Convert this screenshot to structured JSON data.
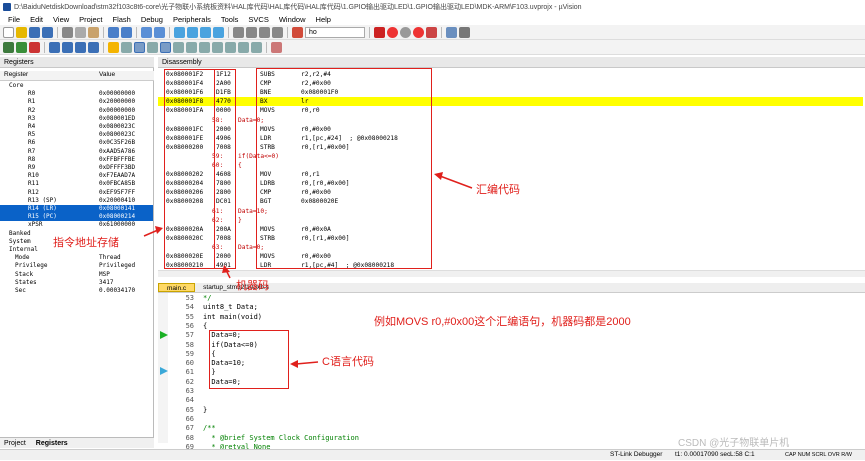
{
  "window": {
    "title": "D:\\BaiduNetdiskDownload\\stm32f103c8t6-core\\光子物联小系统板资料\\HAL库代码\\HAL库代码\\HAL库代码\\1.GPIO输出驱动LED\\1.GPIO输出驱动LED\\MDK-ARM\\F103.uvprojx - µVision"
  },
  "menu": [
    "File",
    "Edit",
    "View",
    "Project",
    "Flash",
    "Debug",
    "Peripherals",
    "Tools",
    "SVCS",
    "Window",
    "Help"
  ],
  "toolbar": {
    "find_text": "ho"
  },
  "registers": {
    "title": "Registers",
    "col_register": "Register",
    "col_value": "Value",
    "core_label": "Core",
    "rows": [
      {
        "name": "R0",
        "value": "0x00000000"
      },
      {
        "name": "R1",
        "value": "0x20000000"
      },
      {
        "name": "R2",
        "value": "0x00000000"
      },
      {
        "name": "R3",
        "value": "0x080001ED"
      },
      {
        "name": "R4",
        "value": "0x0800023C"
      },
      {
        "name": "R5",
        "value": "0x0800023C"
      },
      {
        "name": "R6",
        "value": "0x0C35F26B"
      },
      {
        "name": "R7",
        "value": "0xAAD5A786"
      },
      {
        "name": "R8",
        "value": "0xFFBFFFBE"
      },
      {
        "name": "R9",
        "value": "0xDFFFF3BD"
      },
      {
        "name": "R10",
        "value": "0xF7EAAD7A"
      },
      {
        "name": "R11",
        "value": "0x0FBCA85B"
      },
      {
        "name": "R12",
        "value": "0xEF95F7FF"
      },
      {
        "name": "R13 (SP)",
        "value": "0x20000410"
      },
      {
        "name": "R14 (LR)",
        "value": "0x08000141"
      },
      {
        "name": "R15 (PC)",
        "value": "0x08000214"
      },
      {
        "name": "xPSR",
        "value": "0x61000000"
      }
    ],
    "groups": [
      "Banked",
      "System",
      "Internal"
    ],
    "internal": [
      {
        "name": "Mode",
        "value": "Thread"
      },
      {
        "name": "Privilege",
        "value": "Privileged"
      },
      {
        "name": "Stack",
        "value": "MSP"
      },
      {
        "name": "States",
        "value": "3417"
      },
      {
        "name": "Sec",
        "value": "0.00034170"
      }
    ],
    "tab_project": "Project",
    "tab_registers": "Registers"
  },
  "disassembly": {
    "title": "Disassembly",
    "rows": [
      {
        "addr": "0x080001F2",
        "code": "1F12",
        "mn": "SUBS",
        "op": "r2,r2,#4"
      },
      {
        "addr": "0x080001F4",
        "code": "2A00",
        "mn": "CMP",
        "op": "r2,#0x00"
      },
      {
        "addr": "0x080001F6",
        "code": "D1FB",
        "mn": "BNE",
        "op": "0x080001F0"
      },
      {
        "addr": "0x080001F8",
        "code": "4770",
        "mn": "BX",
        "op": "lr",
        "hl": true
      },
      {
        "addr": "0x080001FA",
        "code": "0000",
        "mn": "MOVS",
        "op": "r0,r0"
      },
      {
        "src_num": "58:",
        "src_txt": "Data=0;"
      },
      {
        "addr": "0x080001FC",
        "code": "2000",
        "mn": "MOVS",
        "op": "r0,#0x00"
      },
      {
        "addr": "0x080001FE",
        "code": "4906",
        "mn": "LDR",
        "op": "r1,[pc,#24]  ; @0x08000218"
      },
      {
        "addr": "0x08000200",
        "code": "7008",
        "mn": "STRB",
        "op": "r0,[r1,#0x00]"
      },
      {
        "src_num": "59:",
        "src_txt": "if(Data<=0)"
      },
      {
        "src_num": "60:",
        "src_txt": "{"
      },
      {
        "addr": "0x08000202",
        "code": "4608",
        "mn": "MOV",
        "op": "r0,r1"
      },
      {
        "addr": "0x08000204",
        "code": "7800",
        "mn": "LDRB",
        "op": "r0,[r0,#0x00]"
      },
      {
        "addr": "0x08000206",
        "code": "2800",
        "mn": "CMP",
        "op": "r0,#0x00"
      },
      {
        "addr": "0x08000208",
        "code": "DC01",
        "mn": "BGT",
        "op": "0x0800020E"
      },
      {
        "src_num": "61:",
        "src_txt": "Data=10;"
      },
      {
        "src_num": "62:",
        "src_txt": "}"
      },
      {
        "addr": "0x0800020A",
        "code": "200A",
        "mn": "MOVS",
        "op": "r0,#0x0A"
      },
      {
        "addr": "0x0800020C",
        "code": "7008",
        "mn": "STRB",
        "op": "r0,[r1,#0x00]"
      },
      {
        "src_num": "63:",
        "src_txt": "Data=0;"
      },
      {
        "addr": "0x0800020E",
        "code": "2000",
        "mn": "MOVS",
        "op": "r0,#0x00"
      },
      {
        "addr": "0x08000210",
        "code": "4901",
        "mn": "LDR",
        "op": "r1,[pc,#4]  ; @0x08000218"
      }
    ]
  },
  "editor": {
    "tabs": [
      "main.c",
      "startup_stm32f103xb.s"
    ],
    "lines": [
      {
        "n": "53",
        "t": "*/",
        "cls": "cm"
      },
      {
        "n": "54",
        "t": "uint8_t Data;"
      },
      {
        "n": "55",
        "t": "int main(void)"
      },
      {
        "n": "56",
        "t": "{"
      },
      {
        "n": "57",
        "t": "  Data=0;"
      },
      {
        "n": "58",
        "t": "  if(Data<=0)"
      },
      {
        "n": "59",
        "t": "  {"
      },
      {
        "n": "60",
        "t": "  Data=10;"
      },
      {
        "n": "61",
        "t": "  }"
      },
      {
        "n": "62",
        "t": "  Data=0;"
      },
      {
        "n": "63",
        "t": ""
      },
      {
        "n": "64",
        "t": ""
      },
      {
        "n": "65",
        "t": "}"
      },
      {
        "n": "66",
        "t": ""
      },
      {
        "n": "67",
        "t": "/**",
        "cls": "cm"
      },
      {
        "n": "68",
        "t": "  * @brief System Clock Configuration",
        "cls": "cm"
      },
      {
        "n": "69",
        "t": "  * @retval None",
        "cls": "cm"
      },
      {
        "n": "",
        "t": "  */",
        "cls": "cm"
      }
    ]
  },
  "annotations": {
    "asm": "汇编代码",
    "addr": "指令地址存储",
    "machine": "机器码",
    "example": "例如MOVS r0,#0x00这个汇编语句，机器码都是2000",
    "c_code": "C语言代码"
  },
  "status": {
    "debugger": "ST-Link Debugger",
    "time": "t1: 0.00017090 sec",
    "pos": "L:58 C:1",
    "flags": "CAP  NUM  SCRL  OVR  R/W",
    "watermark": "CSDN @光子物联单片机"
  },
  "colors": {
    "red": "#e0201c",
    "highlight": "#ffff00",
    "select": "#0a62c8"
  }
}
